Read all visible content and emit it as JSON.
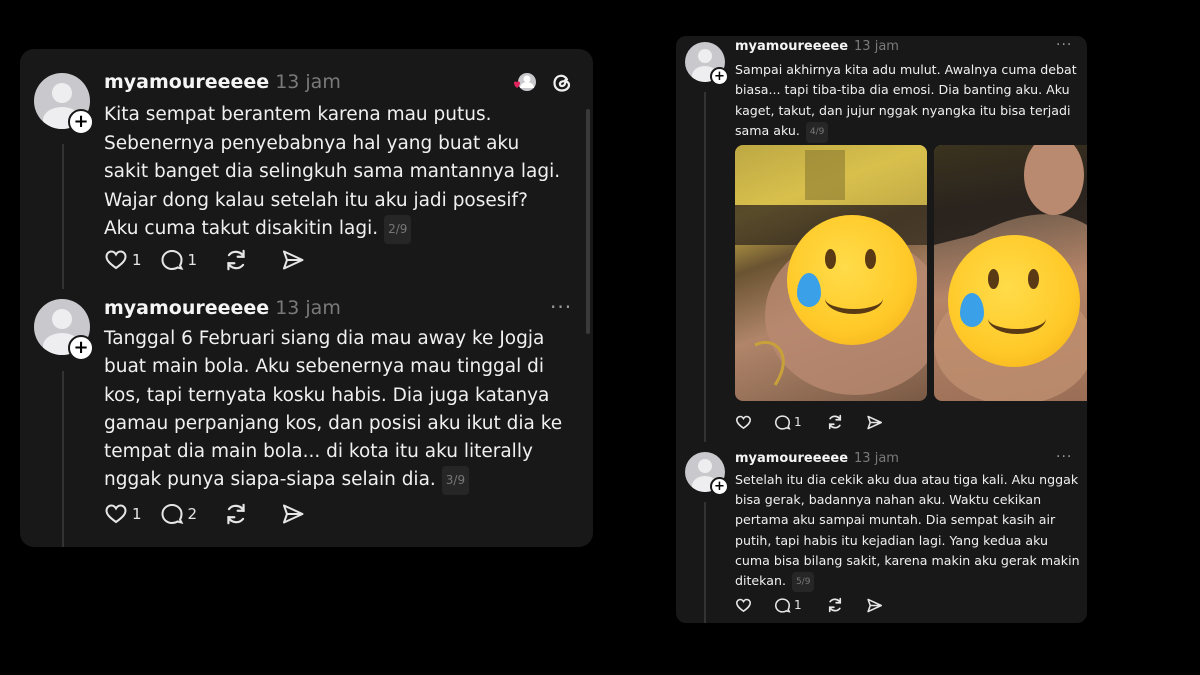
{
  "left_card": {
    "post1": {
      "username": "myamoureeeee",
      "time": "13 jam",
      "text": "Kita sempat berantem karena mau putus. Sebenernya penyebabnya hal yang buat aku sakit banget dia selingkuh sama mantannya lagi. Wajar dong kalau setelah itu aku jadi posesif? Aku cuma takut disakitin lagi.",
      "counter": "2/9",
      "likes": "1",
      "replies": "1"
    },
    "post2": {
      "username": "myamoureeeee",
      "time": "13 jam",
      "menu": "···",
      "text": "Tanggal 6 Februari siang dia mau away ke Jogja buat main bola. Aku sebenernya mau tinggal di kos, tapi ternyata kosku habis. Dia juga katanya gamau perpanjang kos, dan posisi aku ikut dia ke tempat dia main bola... di kota itu aku literally nggak punya siapa-siapa selain dia.",
      "counter": "3/9",
      "likes": "1",
      "replies": "2"
    }
  },
  "right_card": {
    "post1": {
      "username": "myamoureeeee",
      "time": "13 jam",
      "menu": "···",
      "text": "Sampai akhirnya kita adu mulut. Awalnya cuma debat biasa... tapi tiba-tiba dia emosi. Dia banting aku. Aku kaget, takut, dan jujur nggak nyangka itu bisa terjadi sama aku.",
      "counter": "4/9",
      "replies": "1",
      "photos": [
        {
          "emoji": "🥲",
          "overlay": "😢"
        },
        {
          "emoji": "🥲",
          "overlay": "😢"
        }
      ]
    },
    "post2": {
      "username": "myamoureeeee",
      "time": "13 jam",
      "menu": "···",
      "text": "Setelah itu dia cekik aku dua atau tiga kali. Aku nggak bisa gerak, badannya nahan aku. Waktu cekikan pertama aku sampai muntah. Dia sempat kasih air putih, tapi habis itu kejadian lagi. Yang kedua aku cuma bisa bilang sakit, karena makin aku gerak makin ditekan.",
      "counter": "5/9",
      "replies": "1"
    }
  },
  "colors": {
    "background": "#000000",
    "card": "#181818",
    "heart_red": "#e0245e",
    "emoji_yellow": "#ffcc33",
    "tear_blue": "#3aa0e8"
  }
}
